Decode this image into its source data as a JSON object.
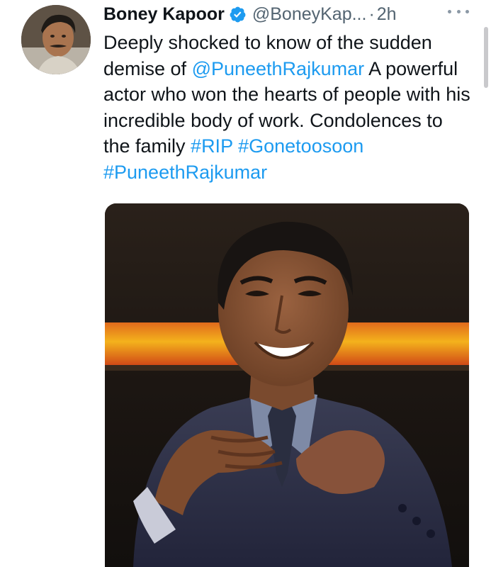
{
  "tweet": {
    "author": {
      "display_name": "Boney Kapoor",
      "handle": "@BoneyKap...",
      "verified": true
    },
    "separator": "·",
    "time": "2h",
    "more_icon": "ellipsis-icon",
    "text": {
      "segments": [
        {
          "type": "text",
          "value": "Deeply shocked to know of the sudden demise of "
        },
        {
          "type": "mention",
          "value": "@PuneethRajkumar"
        },
        {
          "type": "text",
          "value": " A powerful actor who won the hearts of people with his incredible body of work. Condolences to the family "
        },
        {
          "type": "hashtag",
          "value": "#RIP"
        },
        {
          "type": "text",
          "value": " "
        },
        {
          "type": "hashtag",
          "value": "#Gonetoosoon"
        },
        {
          "type": "text",
          "value": " "
        },
        {
          "type": "hashtag",
          "value": "#PuneethRajkumar"
        }
      ]
    },
    "media": {
      "kind": "photo"
    }
  },
  "colors": {
    "link": "#1d9bf0",
    "verified_badge": "#1d9bf0",
    "secondary_text": "#536471",
    "primary_text": "#0f1419"
  }
}
